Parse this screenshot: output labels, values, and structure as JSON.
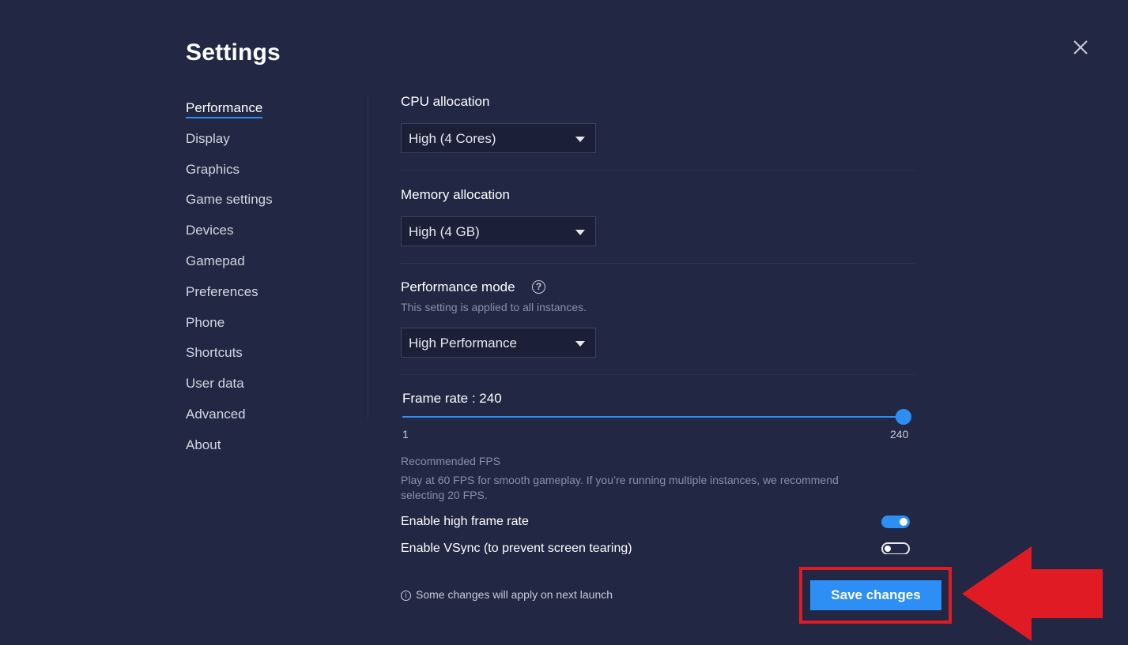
{
  "title": "Settings",
  "sidebar": {
    "items": [
      {
        "label": "Performance",
        "active": true
      },
      {
        "label": "Display"
      },
      {
        "label": "Graphics"
      },
      {
        "label": "Game settings"
      },
      {
        "label": "Devices"
      },
      {
        "label": "Gamepad"
      },
      {
        "label": "Preferences"
      },
      {
        "label": "Phone"
      },
      {
        "label": "Shortcuts"
      },
      {
        "label": "User data"
      },
      {
        "label": "Advanced"
      },
      {
        "label": "About"
      }
    ]
  },
  "performance": {
    "cpu": {
      "label": "CPU allocation",
      "value": "High (4 Cores)"
    },
    "memory": {
      "label": "Memory allocation",
      "value": "High (4 GB)"
    },
    "mode": {
      "label": "Performance mode",
      "help_icon": "?",
      "note": "This setting is applied to all instances.",
      "value": "High Performance"
    },
    "frame_rate": {
      "label": "Frame rate : 240",
      "value": 240,
      "min": 1,
      "max": 240,
      "min_label": "1",
      "max_label": "240"
    },
    "recommended": {
      "title": "Recommended FPS",
      "body_line1": "Play at 60 FPS for smooth gameplay. If you’re running multiple instances, we recommend",
      "body_line2": "selecting 20 FPS."
    },
    "high_frame_rate": {
      "label": "Enable high frame rate",
      "enabled": true
    },
    "vsync": {
      "label": "Enable VSync (to prevent screen tearing)",
      "enabled": false
    }
  },
  "footer": {
    "info_icon": "i",
    "note": "Some changes will apply on next launch",
    "save_label": "Save changes"
  },
  "colors": {
    "background": "#222744",
    "accent": "#2d8ef5",
    "highlight": "#e01b24"
  }
}
